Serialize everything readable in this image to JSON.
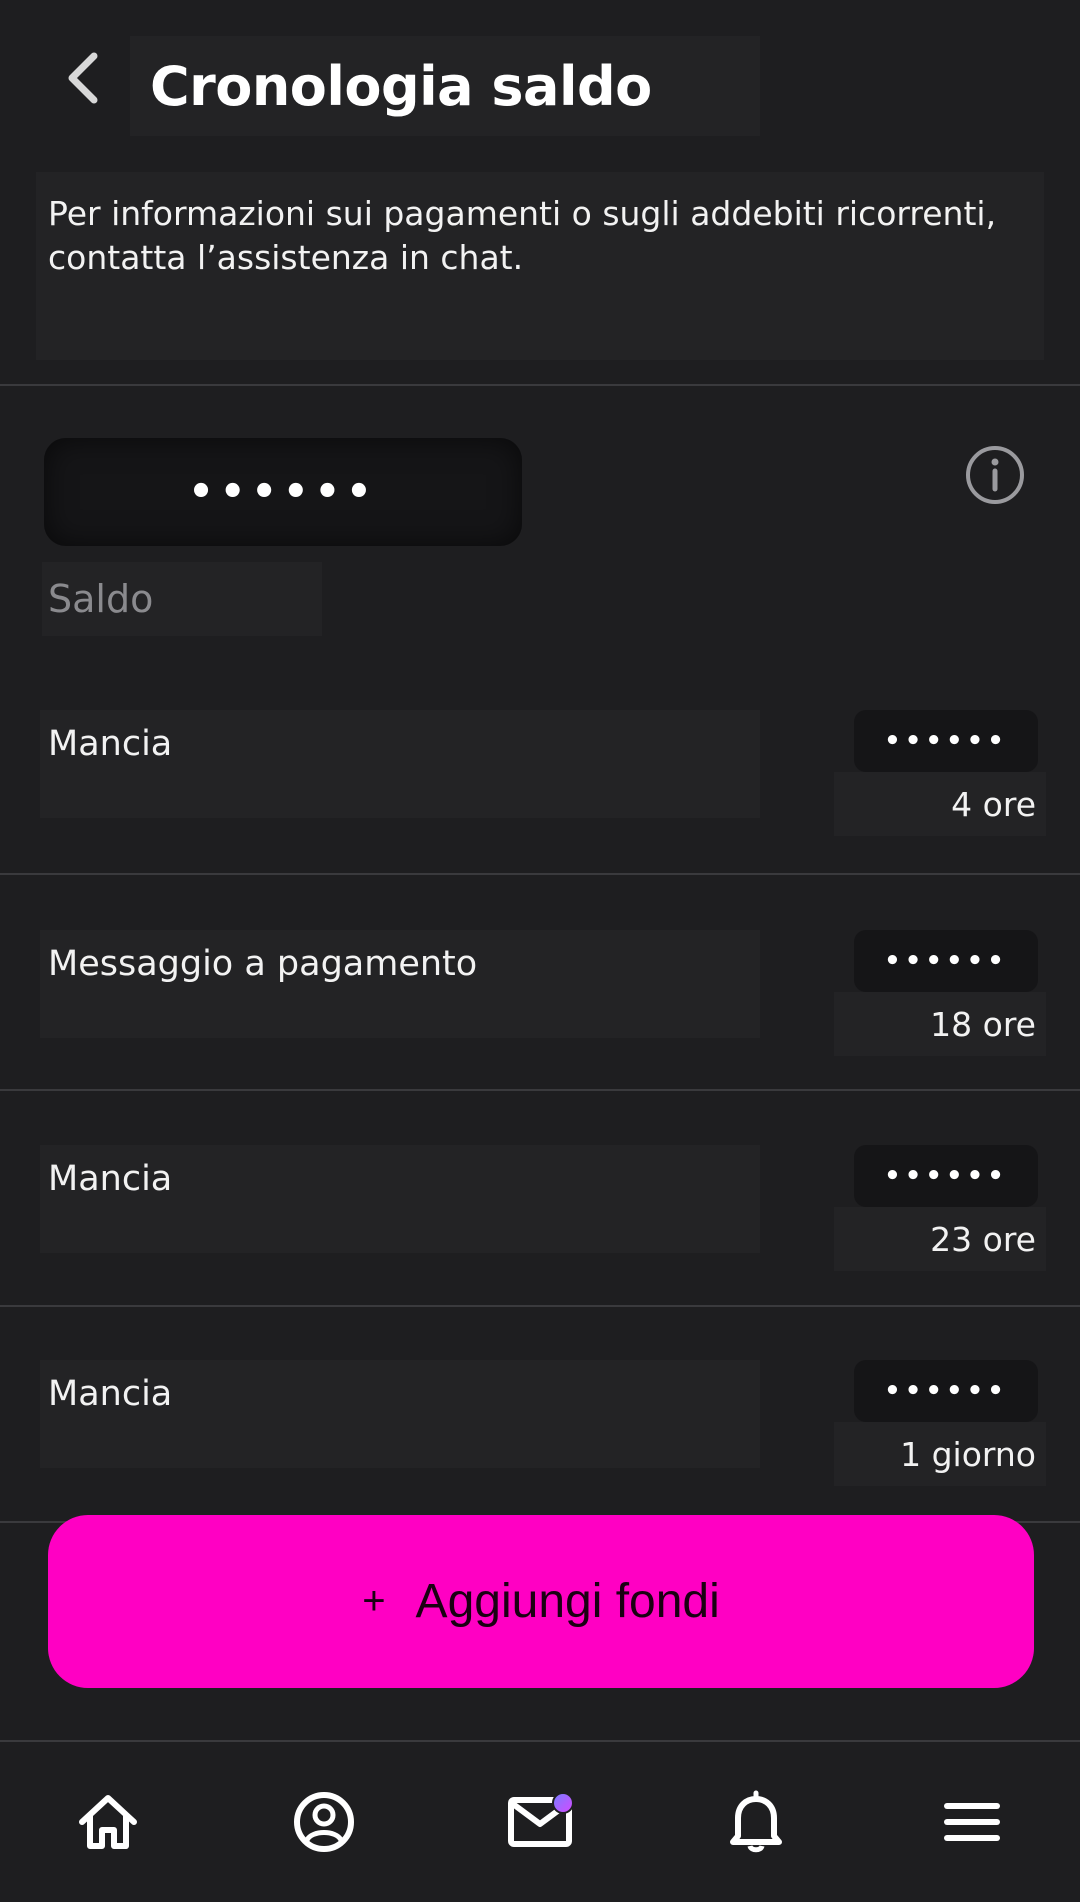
{
  "header": {
    "title": "Cronologia saldo"
  },
  "info": {
    "text": "Per informazioni sui pagamenti o sugli addebiti ricorrenti, contatta l’assistenza in chat."
  },
  "balance": {
    "value": "••••••",
    "label": "Saldo"
  },
  "transactions": [
    {
      "label": "Mancia",
      "amount": "••••••",
      "time": "4 ore"
    },
    {
      "label": "Messaggio a pagamento",
      "amount": "••••••",
      "time": "18 ore"
    },
    {
      "label": "Mancia",
      "amount": "••••••",
      "time": "23 ore"
    },
    {
      "label": "Mancia",
      "amount": "••••••",
      "time": "1 giorno"
    }
  ],
  "add_funds": {
    "plus": "+",
    "label": "Aggiungi fondi"
  },
  "colors": {
    "accent": "#ff00c3",
    "background": "#1e1e20"
  },
  "nav": {
    "icons": [
      "home-icon",
      "profile-icon",
      "messages-icon",
      "notifications-icon",
      "menu-icon"
    ]
  }
}
